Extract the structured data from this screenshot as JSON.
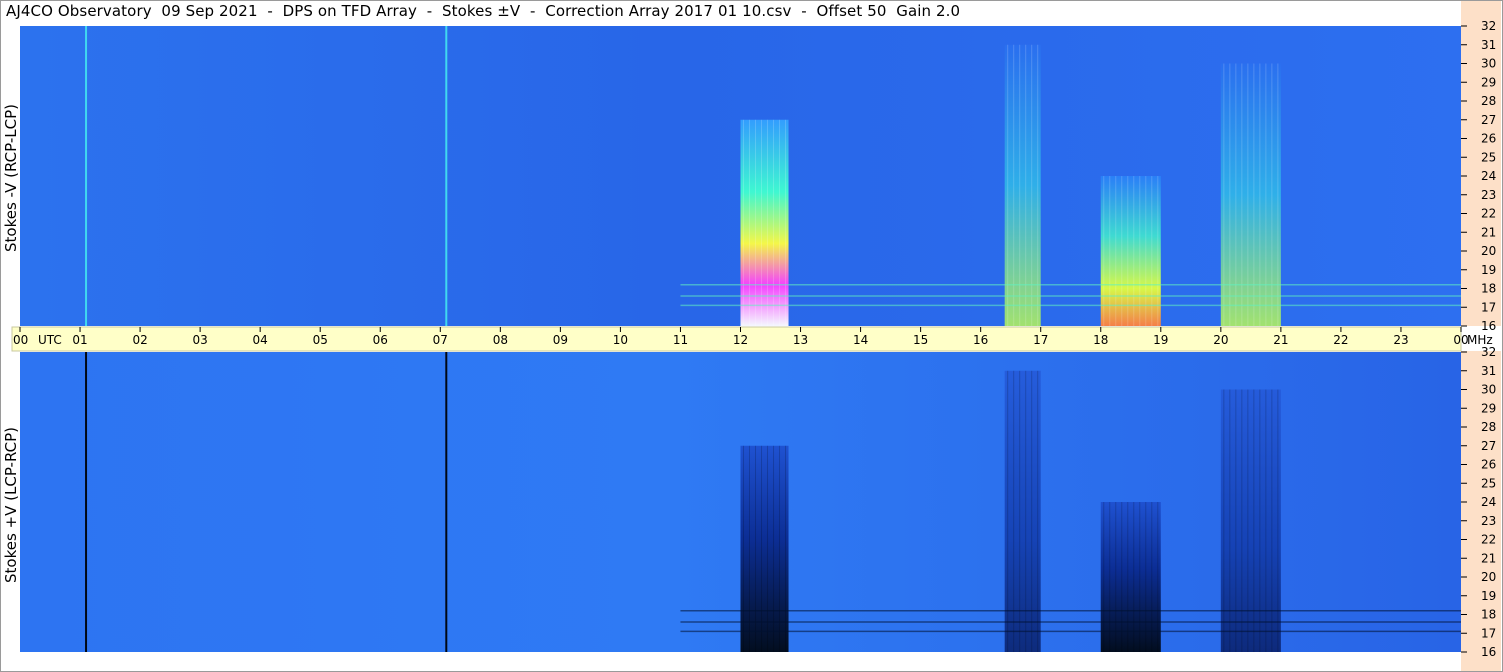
{
  "title": "AJ4CO Observatory  09 Sep 2021  -  DPS on TFD Array  -  Stokes ±V  -  Correction Array 2017 01 10.csv  -  Offset 50  Gain 2.0",
  "colors": {
    "background_blue": "#2a6ff0",
    "time_axis_band": "#ffffc8",
    "freq_axis_band": "#fde0c8",
    "strong_negative": "#000814",
    "strong_positive": "#ff30ff"
  },
  "chart_data": [
    {
      "type": "heatmap",
      "panel": "top",
      "ylabel": "Stokes -V (RCP-LCP)",
      "x_units": "UTC hour",
      "xlim": [
        0,
        24
      ],
      "y_units": "MHz",
      "ylim": [
        16,
        32
      ],
      "y_ticks": [
        16,
        17,
        18,
        19,
        20,
        21,
        22,
        23,
        24,
        25,
        26,
        27,
        28,
        29,
        30,
        31,
        32
      ],
      "features": [
        {
          "x": [
            12.0,
            12.8
          ],
          "y": [
            16,
            27
          ],
          "level": "strong"
        },
        {
          "x": [
            16.4,
            17.0
          ],
          "y": [
            16,
            31
          ],
          "level": "medium"
        },
        {
          "x": [
            18.0,
            19.0
          ],
          "y": [
            16,
            24
          ],
          "level": "strong"
        },
        {
          "x": [
            20.0,
            21.0
          ],
          "y": [
            16,
            30
          ],
          "level": "medium"
        },
        {
          "x": [
            1.1,
            1.1
          ],
          "y": [
            16,
            32
          ],
          "level": "line"
        },
        {
          "x": [
            7.1,
            7.1
          ],
          "y": [
            16,
            32
          ],
          "level": "line"
        }
      ]
    },
    {
      "type": "heatmap",
      "panel": "bottom",
      "ylabel": "Stokes +V (LCP-RCP)",
      "x_units": "UTC hour",
      "xlim": [
        0,
        24
      ],
      "y_units": "MHz",
      "ylim": [
        16,
        32
      ],
      "y_ticks": [
        16,
        17,
        18,
        19,
        20,
        21,
        22,
        23,
        24,
        25,
        26,
        27,
        28,
        29,
        30,
        31,
        32
      ],
      "features": [
        {
          "x": [
            12.0,
            12.8
          ],
          "y": [
            16,
            27
          ],
          "level": "strong"
        },
        {
          "x": [
            16.4,
            17.0
          ],
          "y": [
            16,
            31
          ],
          "level": "medium"
        },
        {
          "x": [
            18.0,
            19.0
          ],
          "y": [
            16,
            24
          ],
          "level": "strong"
        },
        {
          "x": [
            20.0,
            21.0
          ],
          "y": [
            16,
            30
          ],
          "level": "medium"
        },
        {
          "x": [
            1.1,
            1.1
          ],
          "y": [
            16,
            32
          ],
          "level": "line"
        },
        {
          "x": [
            7.1,
            7.1
          ],
          "y": [
            16,
            32
          ],
          "level": "line"
        }
      ]
    }
  ],
  "time_axis": {
    "labels": [
      "00",
      "01",
      "02",
      "03",
      "04",
      "05",
      "06",
      "07",
      "08",
      "09",
      "10",
      "11",
      "12",
      "13",
      "14",
      "15",
      "16",
      "17",
      "18",
      "19",
      "20",
      "21",
      "22",
      "23",
      "00"
    ],
    "utc_label": "UTC",
    "unit_label": "MHz"
  }
}
